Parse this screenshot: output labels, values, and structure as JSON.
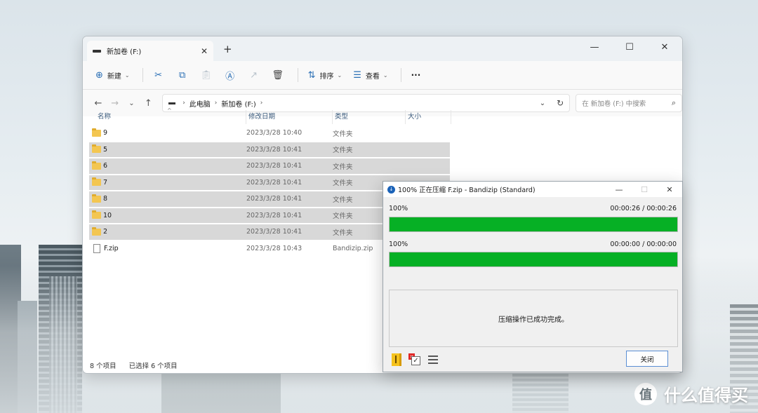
{
  "watermark": {
    "brand": "什么值得买",
    "badge": "值"
  },
  "explorer": {
    "tab_title": "新加卷 (F:)",
    "toolbar": {
      "new_label": "新建",
      "sort_label": "排序",
      "view_label": "查看",
      "more_label": "···"
    },
    "address": {
      "crumbs": [
        "此电脑",
        "新加卷 (F:)"
      ]
    },
    "search_placeholder": "在 新加卷 (F:) 中搜索",
    "columns": {
      "name": "名称",
      "date": "修改日期",
      "type": "类型",
      "size": "大小"
    },
    "rows": [
      {
        "name": "9",
        "date": "2023/3/28 10:40",
        "type": "文件夹",
        "selected": false,
        "kind": "folder"
      },
      {
        "name": "5",
        "date": "2023/3/28 10:41",
        "type": "文件夹",
        "selected": true,
        "kind": "folder"
      },
      {
        "name": "6",
        "date": "2023/3/28 10:41",
        "type": "文件夹",
        "selected": true,
        "kind": "folder"
      },
      {
        "name": "7",
        "date": "2023/3/28 10:41",
        "type": "文件夹",
        "selected": true,
        "kind": "folder"
      },
      {
        "name": "8",
        "date": "2023/3/28 10:41",
        "type": "文件夹",
        "selected": true,
        "kind": "folder"
      },
      {
        "name": "10",
        "date": "2023/3/28 10:41",
        "type": "文件夹",
        "selected": true,
        "kind": "folder"
      },
      {
        "name": "2",
        "date": "2023/3/28 10:41",
        "type": "文件夹",
        "selected": true,
        "kind": "folder"
      },
      {
        "name": "F.zip",
        "date": "2023/3/28 10:43",
        "type": "Bandizip.zip",
        "selected": false,
        "kind": "file"
      }
    ],
    "status": {
      "count": "8 个项目",
      "selected": "已选择 6 个项目"
    }
  },
  "bandizip": {
    "title": "100% 正在压缩 F.zip - Bandizip (Standard)",
    "progress1": {
      "percent_text": "100%",
      "time": "00:00:26 / 00:00:26",
      "value": 1.0
    },
    "progress2": {
      "percent_text": "100%",
      "time": "00:00:00 / 00:00:00",
      "value": 1.0
    },
    "message": "压缩操作已成功完成。",
    "close_label": "关闭",
    "colors": {
      "progress": "#06b025"
    }
  }
}
